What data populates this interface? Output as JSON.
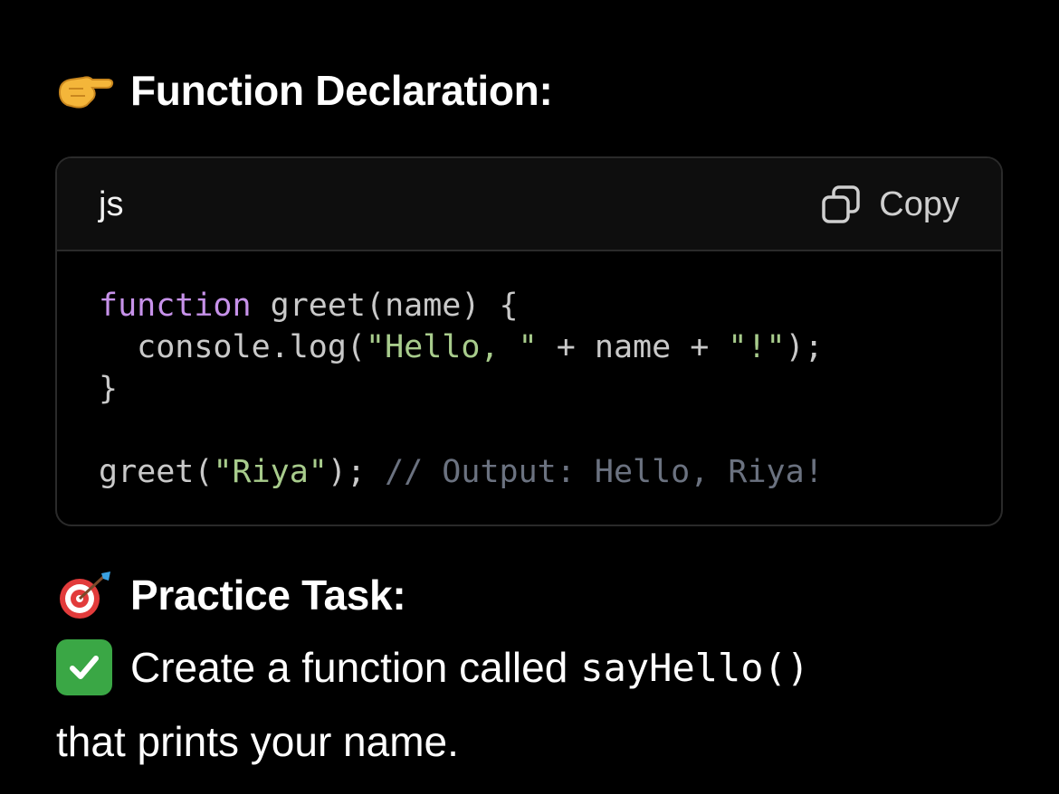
{
  "heading_declaration": {
    "icon": "pointing-hand-icon",
    "text": "Function Declaration:"
  },
  "code_block": {
    "language": "js",
    "copy_label": "Copy",
    "copy_icon": "copy-icon",
    "lines": [
      [
        {
          "t": "kw",
          "v": "function"
        },
        {
          "t": "plain",
          "v": " greet(name) {"
        }
      ],
      [
        {
          "t": "plain",
          "v": "  console.log("
        },
        {
          "t": "str",
          "v": "\"Hello, \""
        },
        {
          "t": "plain",
          "v": " + name + "
        },
        {
          "t": "str",
          "v": "\"!\""
        },
        {
          "t": "plain",
          "v": ");"
        }
      ],
      [
        {
          "t": "plain",
          "v": "}"
        }
      ],
      [],
      [
        {
          "t": "plain",
          "v": "greet("
        },
        {
          "t": "str",
          "v": "\"Riya\""
        },
        {
          "t": "plain",
          "v": "); "
        },
        {
          "t": "cm",
          "v": "// Output: Hello, Riya!"
        }
      ]
    ]
  },
  "heading_practice": {
    "icon": "dart-target-icon",
    "text": "Practice Task:"
  },
  "task": {
    "icon": "checkmark-icon",
    "line1_text": "Create a function called",
    "inline_code": "sayHello()",
    "line2_text": "that prints your name."
  },
  "colors": {
    "keyword": "#c792ea",
    "string": "#a8cc8c",
    "comment": "#6b7280",
    "check_green": "#3aa745",
    "background": "#000000"
  }
}
